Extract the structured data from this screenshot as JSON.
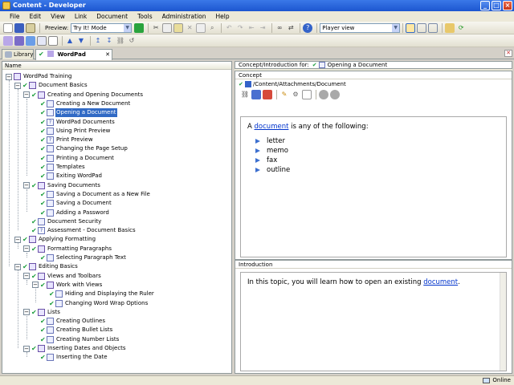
{
  "window": {
    "title": "Content - Developer"
  },
  "menu": [
    "File",
    "Edit",
    "View",
    "Link",
    "Document",
    "Tools",
    "Administration",
    "Help"
  ],
  "toolbar": {
    "preview_label": "Preview:",
    "preview_mode": "Try It! Mode",
    "player_view": "Player view"
  },
  "tabs": [
    {
      "label": "Library",
      "icon": "library-icon"
    },
    {
      "label": "WordPad Training",
      "icon": "course-icon",
      "close": "✕"
    }
  ],
  "tree": {
    "column_header": "Name",
    "nodes": [
      {
        "label": "WordPad Training",
        "level": 0,
        "icon": "book",
        "expanded": true,
        "check": false
      },
      {
        "label": "Document Basics",
        "level": 1,
        "icon": "book",
        "expanded": true,
        "check": true
      },
      {
        "label": "Creating and Opening Documents",
        "level": 2,
        "icon": "book",
        "expanded": true,
        "check": true
      },
      {
        "label": "Creating a New Document",
        "level": 3,
        "icon": "task",
        "check": true
      },
      {
        "label": "Opening a Document",
        "level": 3,
        "icon": "task",
        "check": true,
        "selected": true
      },
      {
        "label": "WordPad Documents",
        "level": 3,
        "icon": "question",
        "check": true
      },
      {
        "label": "Using Print Preview",
        "level": 3,
        "icon": "task",
        "check": true
      },
      {
        "label": "Print Preview",
        "level": 3,
        "icon": "question",
        "check": true
      },
      {
        "label": "Changing the Page Setup",
        "level": 3,
        "icon": "task",
        "check": true
      },
      {
        "label": "Printing a Document",
        "level": 3,
        "icon": "task",
        "check": true
      },
      {
        "label": "Templates",
        "level": 3,
        "icon": "doc",
        "check": true
      },
      {
        "label": "Exiting WordPad",
        "level": 3,
        "icon": "task",
        "check": true
      },
      {
        "label": "Saving Documents",
        "level": 2,
        "icon": "book",
        "expanded": true,
        "check": true
      },
      {
        "label": "Saving a Document as a New File",
        "level": 3,
        "icon": "task",
        "check": true
      },
      {
        "label": "Saving a Document",
        "level": 3,
        "icon": "task",
        "check": true
      },
      {
        "label": "Adding a Password",
        "level": 3,
        "icon": "task",
        "check": true
      },
      {
        "label": "Document Security",
        "level": 2,
        "icon": "doc",
        "check": true
      },
      {
        "label": "Assessment - Document Basics",
        "level": 2,
        "icon": "question",
        "check": true
      },
      {
        "label": "Applying Formatting",
        "level": 1,
        "icon": "book",
        "expanded": true,
        "check": true
      },
      {
        "label": "Formatting Paragraphs",
        "level": 2,
        "icon": "book",
        "expanded": true,
        "check": true
      },
      {
        "label": "Selecting Paragraph Text",
        "level": 3,
        "icon": "task",
        "check": true
      },
      {
        "label": "Editing Basics",
        "level": 1,
        "icon": "book",
        "expanded": true,
        "check": true
      },
      {
        "label": "Views and Toolbars",
        "level": 2,
        "icon": "book",
        "expanded": true,
        "check": true
      },
      {
        "label": "Work with Views",
        "level": 3,
        "icon": "book",
        "expanded": true,
        "check": true
      },
      {
        "label": "Hiding and Displaying the Ruler",
        "level": 4,
        "icon": "task",
        "check": true
      },
      {
        "label": "Changing Word Wrap Options",
        "level": 4,
        "icon": "task",
        "check": true
      },
      {
        "label": "Lists",
        "level": 2,
        "icon": "book",
        "expanded": true,
        "check": true
      },
      {
        "label": "Creating Outlines",
        "level": 3,
        "icon": "task",
        "check": true
      },
      {
        "label": "Creating Bullet Lists",
        "level": 3,
        "icon": "task",
        "check": true
      },
      {
        "label": "Creating Number Lists",
        "level": 3,
        "icon": "task",
        "check": true
      },
      {
        "label": "Inserting Dates and Objects",
        "level": 2,
        "icon": "book",
        "expanded": true,
        "check": true
      },
      {
        "label": "Inserting the Date",
        "level": 3,
        "icon": "task",
        "check": true
      }
    ]
  },
  "right": {
    "context_label": "Concept/Introduction for:",
    "context_item": "Opening a Document",
    "concept": {
      "header": "Concept",
      "path": "/Content/Attachments/Document",
      "intro_prefix": "A ",
      "intro_link": "document",
      "intro_suffix": " is any of the following:",
      "bullets": [
        "letter",
        "memo",
        "fax",
        "outline"
      ]
    },
    "introduction": {
      "header": "Introduction",
      "text_prefix": "In this topic, you will learn how to open an existing ",
      "link": "document",
      "text_suffix": "."
    }
  },
  "status": {
    "online": "Online"
  },
  "colors": {
    "check": "#1e9e3e",
    "selection": "#316ac5",
    "link": "#0033cc",
    "title_bar": "#2a64d8"
  }
}
